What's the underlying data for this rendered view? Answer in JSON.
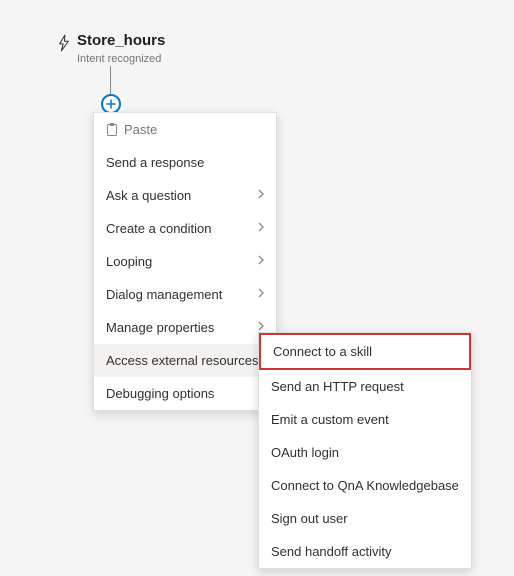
{
  "node": {
    "title": "Store_hours",
    "subtitle": "Intent recognized"
  },
  "menu": {
    "paste": "Paste",
    "items": [
      {
        "label": "Send a response",
        "submenu": false
      },
      {
        "label": "Ask a question",
        "submenu": true
      },
      {
        "label": "Create a condition",
        "submenu": true
      },
      {
        "label": "Looping",
        "submenu": true
      },
      {
        "label": "Dialog management",
        "submenu": true
      },
      {
        "label": "Manage properties",
        "submenu": true
      },
      {
        "label": "Access external resources",
        "submenu": true,
        "hover": true
      },
      {
        "label": "Debugging options",
        "submenu": true
      }
    ]
  },
  "submenu": {
    "items": [
      {
        "label": "Connect to a skill",
        "highlight": true
      },
      {
        "label": "Send an HTTP request"
      },
      {
        "label": "Emit a custom event"
      },
      {
        "label": "OAuth login"
      },
      {
        "label": "Connect to QnA Knowledgebase"
      },
      {
        "label": "Sign out user"
      },
      {
        "label": "Send handoff activity"
      }
    ]
  }
}
